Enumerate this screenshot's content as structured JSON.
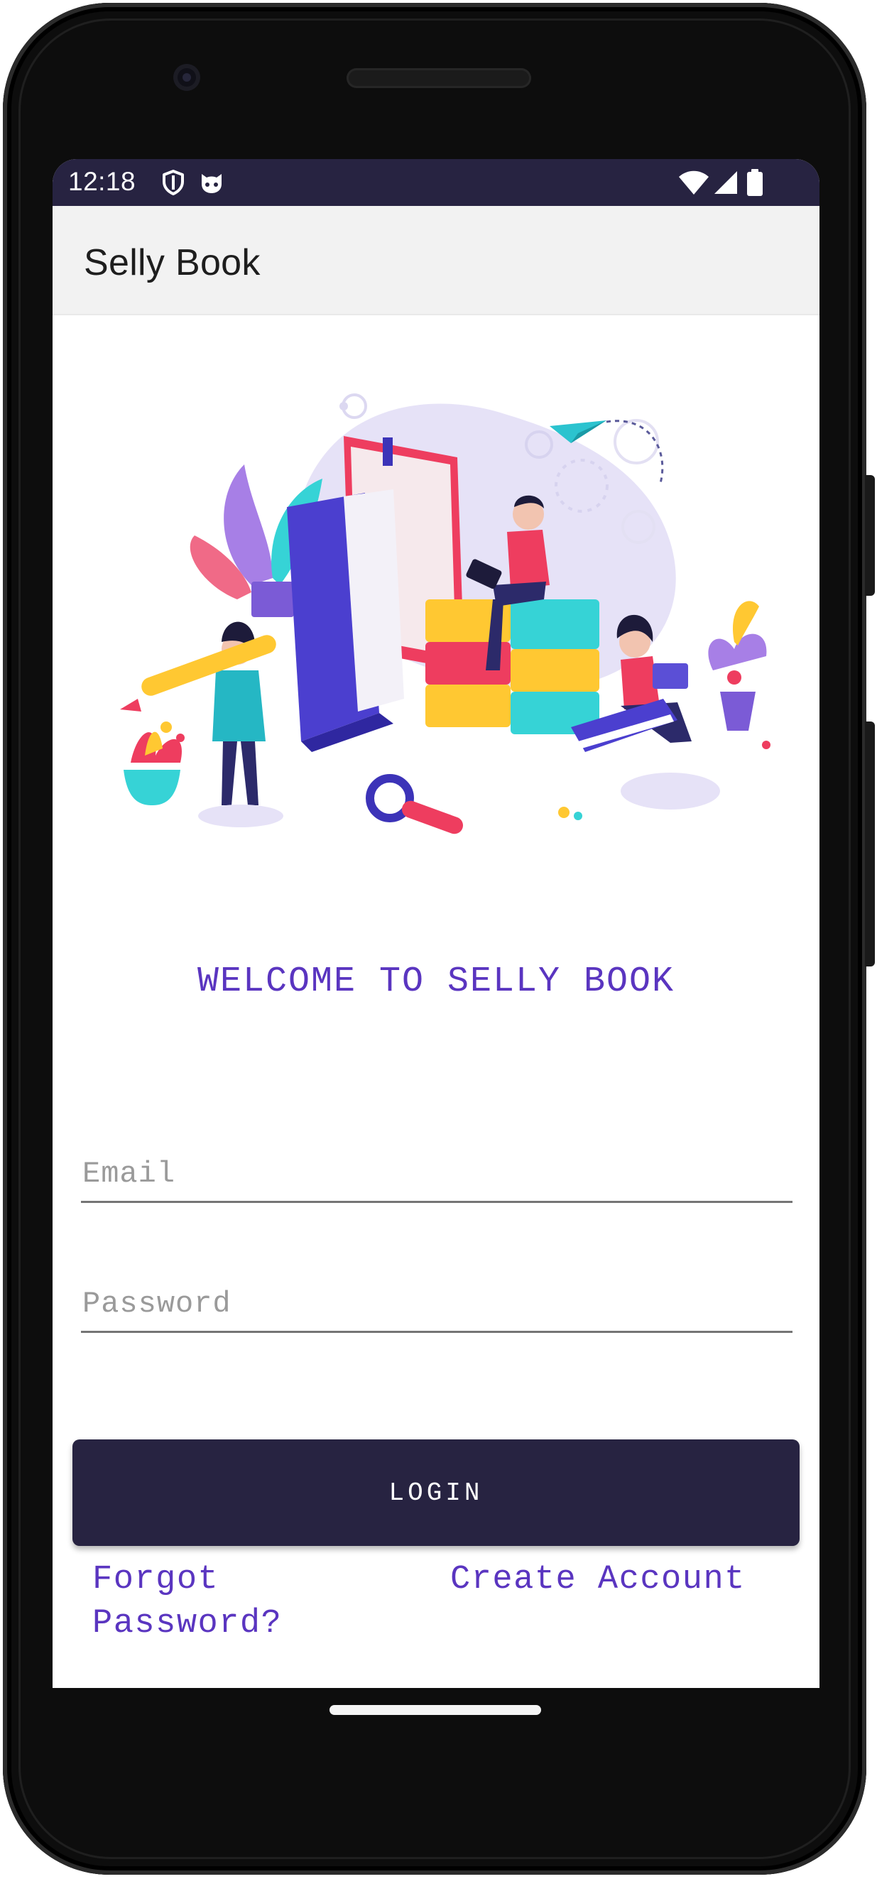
{
  "status_bar": {
    "time": "12:18",
    "icons": [
      "shield-icon",
      "cat-face-icon",
      "wifi-icon",
      "cellular-signal-icon",
      "battery-icon"
    ]
  },
  "app_bar": {
    "title": "Selly Book"
  },
  "hero_image": {
    "icon": "reading-books-illustration"
  },
  "welcome": {
    "text": "WELCOME TO SELLY BOOK"
  },
  "form": {
    "email_placeholder": "Email",
    "email_value": "",
    "password_placeholder": "Password",
    "password_value": ""
  },
  "actions": {
    "login_label": "LOGIN",
    "forgot_password_label": "Forgot Password?",
    "create_account_label": "Create Account"
  },
  "colors": {
    "primary_dark": "#272341",
    "accent_purple": "#5a35c0",
    "app_bar_bg": "#f2f2f2"
  }
}
